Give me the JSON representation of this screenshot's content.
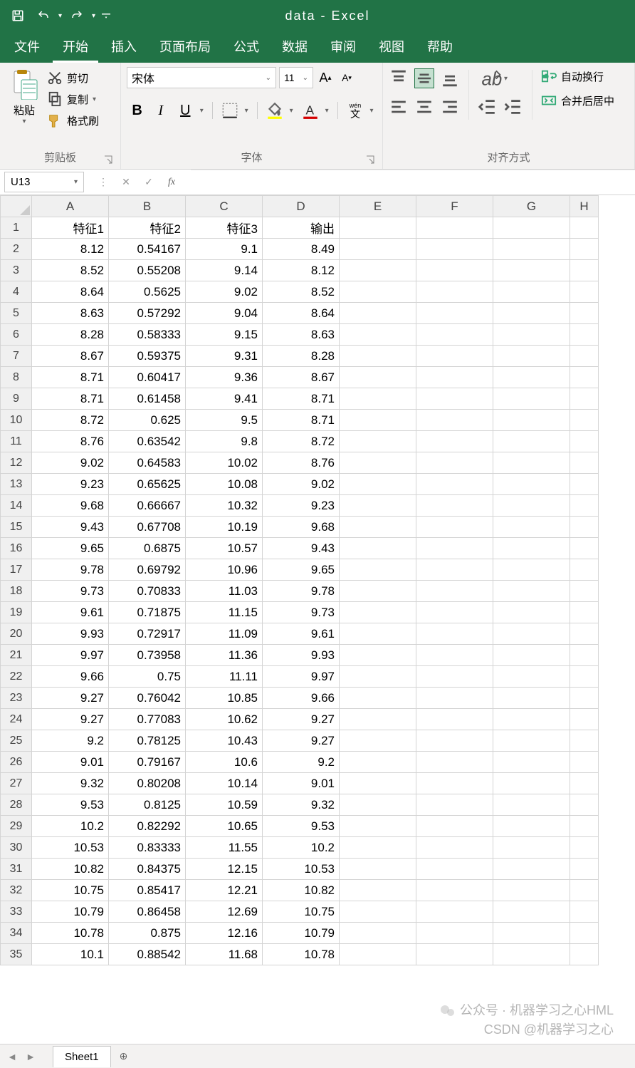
{
  "title": "data  -  Excel",
  "tabs": [
    "文件",
    "开始",
    "插入",
    "页面布局",
    "公式",
    "数据",
    "审阅",
    "视图",
    "帮助"
  ],
  "activeTab": 1,
  "clipboard": {
    "paste": "粘贴",
    "cut": "剪切",
    "copy": "复制",
    "formatPainter": "格式刷",
    "groupLabel": "剪贴板"
  },
  "font": {
    "name": "宋体",
    "size": "11",
    "groupLabel": "字体",
    "wen": "wén",
    "wenHan": "文"
  },
  "alignment": {
    "groupLabel": "对齐方式",
    "wrap": "自动换行",
    "merge": "合并后居中"
  },
  "nameBox": "U13",
  "formula": "",
  "columns": [
    "A",
    "B",
    "C",
    "D",
    "E",
    "F",
    "G",
    "H"
  ],
  "headerRow": [
    "特征1",
    "特征2",
    "特征3",
    "输出"
  ],
  "rows": [
    [
      "8.12",
      "0.54167",
      "9.1",
      "8.49"
    ],
    [
      "8.52",
      "0.55208",
      "9.14",
      "8.12"
    ],
    [
      "8.64",
      "0.5625",
      "9.02",
      "8.52"
    ],
    [
      "8.63",
      "0.57292",
      "9.04",
      "8.64"
    ],
    [
      "8.28",
      "0.58333",
      "9.15",
      "8.63"
    ],
    [
      "8.67",
      "0.59375",
      "9.31",
      "8.28"
    ],
    [
      "8.71",
      "0.60417",
      "9.36",
      "8.67"
    ],
    [
      "8.71",
      "0.61458",
      "9.41",
      "8.71"
    ],
    [
      "8.72",
      "0.625",
      "9.5",
      "8.71"
    ],
    [
      "8.76",
      "0.63542",
      "9.8",
      "8.72"
    ],
    [
      "9.02",
      "0.64583",
      "10.02",
      "8.76"
    ],
    [
      "9.23",
      "0.65625",
      "10.08",
      "9.02"
    ],
    [
      "9.68",
      "0.66667",
      "10.32",
      "9.23"
    ],
    [
      "9.43",
      "0.67708",
      "10.19",
      "9.68"
    ],
    [
      "9.65",
      "0.6875",
      "10.57",
      "9.43"
    ],
    [
      "9.78",
      "0.69792",
      "10.96",
      "9.65"
    ],
    [
      "9.73",
      "0.70833",
      "11.03",
      "9.78"
    ],
    [
      "9.61",
      "0.71875",
      "11.15",
      "9.73"
    ],
    [
      "9.93",
      "0.72917",
      "11.09",
      "9.61"
    ],
    [
      "9.97",
      "0.73958",
      "11.36",
      "9.93"
    ],
    [
      "9.66",
      "0.75",
      "11.11",
      "9.97"
    ],
    [
      "9.27",
      "0.76042",
      "10.85",
      "9.66"
    ],
    [
      "9.27",
      "0.77083",
      "10.62",
      "9.27"
    ],
    [
      "9.2",
      "0.78125",
      "10.43",
      "9.27"
    ],
    [
      "9.01",
      "0.79167",
      "10.6",
      "9.2"
    ],
    [
      "9.32",
      "0.80208",
      "10.14",
      "9.01"
    ],
    [
      "9.53",
      "0.8125",
      "10.59",
      "9.32"
    ],
    [
      "10.2",
      "0.82292",
      "10.65",
      "9.53"
    ],
    [
      "10.53",
      "0.83333",
      "11.55",
      "10.2"
    ],
    [
      "10.82",
      "0.84375",
      "12.15",
      "10.53"
    ],
    [
      "10.75",
      "0.85417",
      "12.21",
      "10.82"
    ],
    [
      "10.79",
      "0.86458",
      "12.69",
      "10.75"
    ],
    [
      "10.78",
      "0.875",
      "12.16",
      "10.79"
    ],
    [
      "10.1",
      "0.88542",
      "11.68",
      "10.78"
    ]
  ],
  "sheetTab": "Sheet1",
  "watermark": {
    "line1": "公众号 · 机器学习之心HML",
    "line2": "CSDN @机器学习之心"
  }
}
